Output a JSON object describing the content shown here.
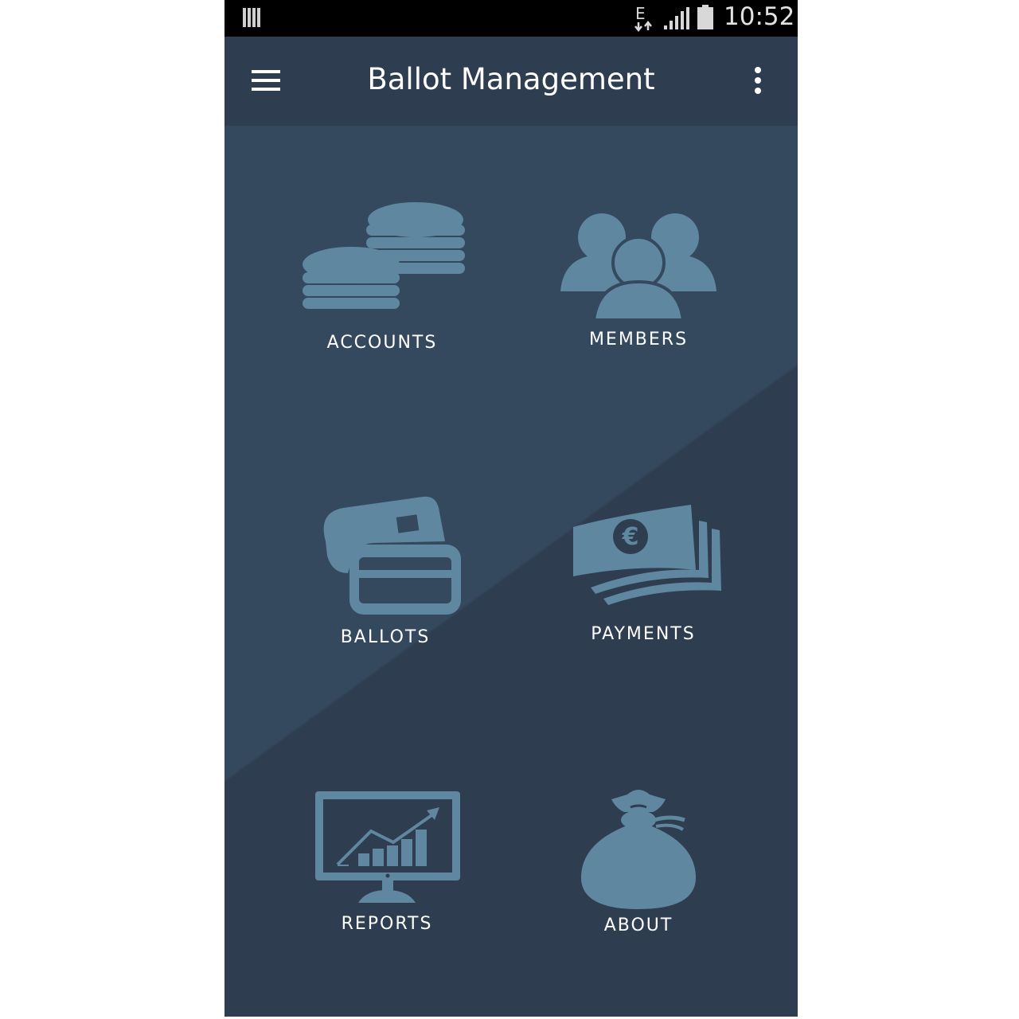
{
  "status_bar": {
    "network_type": "E",
    "time": "10:52",
    "icons": [
      "notification-icon",
      "data-transfer-icon",
      "signal-icon",
      "battery-icon"
    ]
  },
  "toolbar": {
    "title": "Ballot Management",
    "icons": [
      "hamburger-menu-icon",
      "overflow-menu-icon"
    ]
  },
  "tiles": [
    {
      "label": "ACCOUNTS",
      "icon": "coins-icon"
    },
    {
      "label": "MEMBERS",
      "icon": "people-icon"
    },
    {
      "label": "BALLOTS",
      "icon": "cards-icon"
    },
    {
      "label": "PAYMENTS",
      "icon": "euro-banknotes-icon"
    },
    {
      "label": "REPORTS",
      "icon": "chart-monitor-icon"
    },
    {
      "label": "ABOUT",
      "icon": "money-bag-icon"
    }
  ],
  "colors": {
    "background_dark": "#2e3d50",
    "background_light": "#34495e",
    "icon": "#5f879f",
    "text": "#ffffff"
  }
}
